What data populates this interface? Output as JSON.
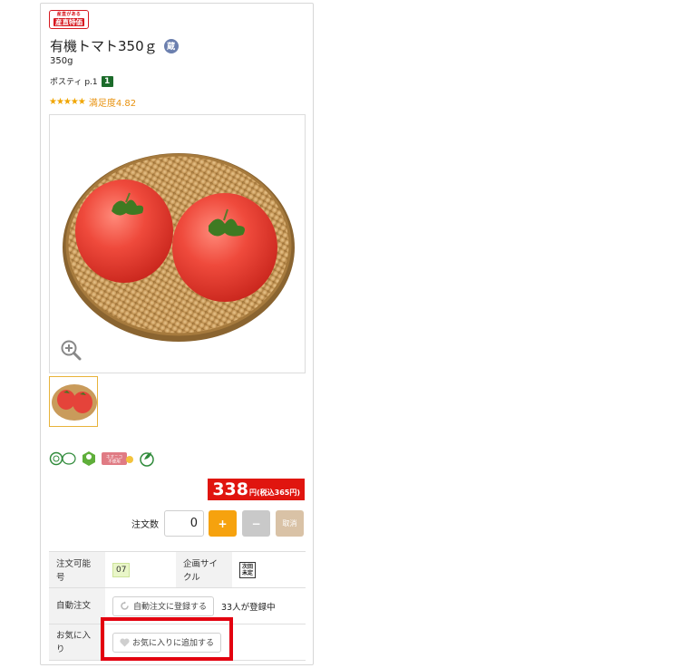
{
  "badge": {
    "top": "産直がある",
    "bottom": "産直特価"
  },
  "product": {
    "title": "有機トマト350ｇ",
    "grade_icon": "蔵",
    "size": "350g",
    "catalog_label": "ポスティ p.1",
    "catalog_page": "1",
    "rating_stars": "★★★★★",
    "rating_text": "満足度4.82"
  },
  "certifications": [
    {
      "icon": "jas-organic-icon"
    },
    {
      "icon": "green-label-icon",
      "text": "産直"
    },
    {
      "icon": "neonico-free-icon",
      "text": "ネオニコ不使用"
    },
    {
      "icon": "eco-leaf-icon"
    }
  ],
  "price": {
    "amount": "338",
    "unit_tax": "円(税込365円)"
  },
  "order": {
    "qty_label": "注文数",
    "qty_value": "0",
    "plus": "+",
    "minus": "−",
    "cancel": "取消"
  },
  "info": {
    "orderable_label": "注文可能号",
    "orderable_value": "07",
    "cycle_label": "企画サイクル",
    "cycle_icon_top": "次回",
    "cycle_icon_bottom": "未定",
    "auto_label": "自動注文",
    "auto_button": "自動注文に登録する",
    "auto_count": "33人が登録中",
    "fav_label": "お気に入り",
    "fav_button": "お気に入りに追加する"
  },
  "colors": {
    "price_red": "#e0150f",
    "plus_orange": "#f6a20e",
    "highlight": "#e3000f"
  }
}
